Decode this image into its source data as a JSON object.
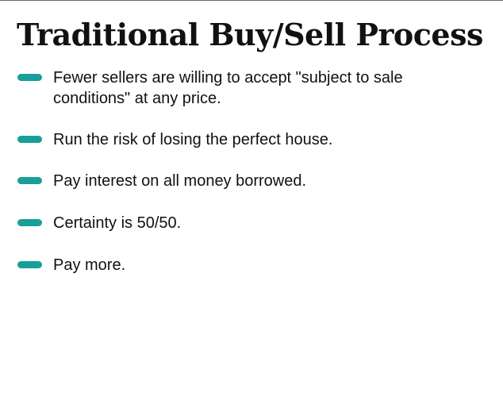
{
  "slide": {
    "title": "Traditional Buy/Sell Process",
    "accent_color": "#1a9e9a",
    "bullets": [
      {
        "text": "Fewer sellers are willing to accept \"subject to sale conditions\" at any price."
      },
      {
        "text": "Run the risk of losing the perfect house."
      },
      {
        "text": "Pay interest on all money borrowed."
      },
      {
        "text": "Certainty is 50/50."
      },
      {
        "text": "Pay more."
      }
    ]
  }
}
